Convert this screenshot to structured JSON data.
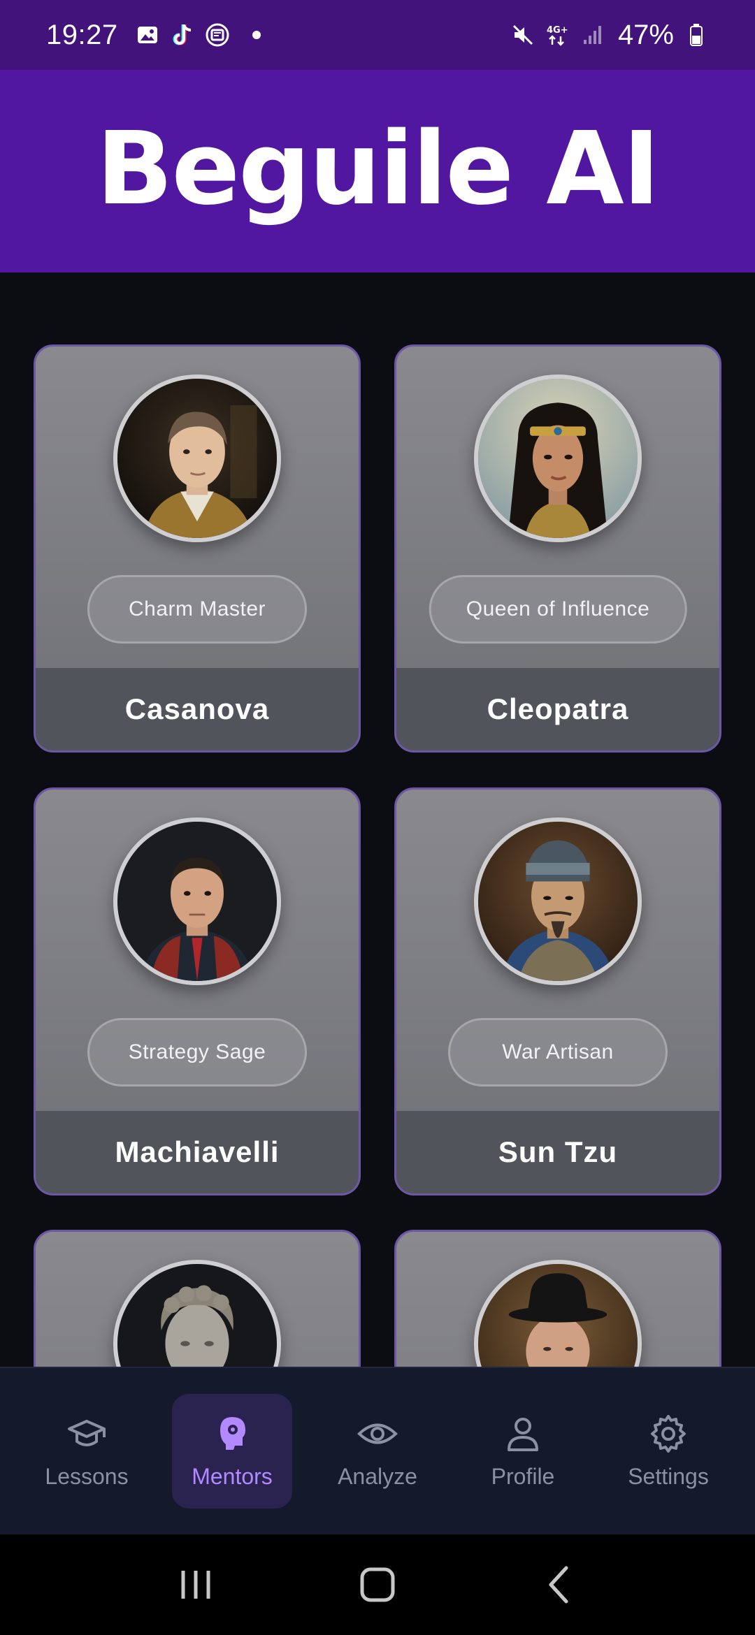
{
  "status_bar": {
    "time": "19:27",
    "battery": "47%",
    "notification_icons": [
      "gallery-icon",
      "tiktok-icon",
      "app-icon",
      "dot-icon"
    ],
    "system_icons": [
      "mute-icon",
      "4g-icon",
      "signal-icon",
      "battery-icon"
    ]
  },
  "header": {
    "title": "Beguile AI"
  },
  "mentors": [
    {
      "name": "Casanova",
      "tag": "Charm Master"
    },
    {
      "name": "Cleopatra",
      "tag": "Queen of Influence"
    },
    {
      "name": "Machiavelli",
      "tag": "Strategy Sage"
    },
    {
      "name": "Sun Tzu",
      "tag": "War Artisan"
    },
    {
      "name": "",
      "tag": ""
    },
    {
      "name": "",
      "tag": ""
    }
  ],
  "bottom_nav": {
    "items": [
      {
        "label": "Lessons",
        "icon": "graduation-cap-icon"
      },
      {
        "label": "Mentors",
        "icon": "mentor-head-icon",
        "active": true
      },
      {
        "label": "Analyze",
        "icon": "eye-icon"
      },
      {
        "label": "Profile",
        "icon": "user-icon"
      },
      {
        "label": "Settings",
        "icon": "gear-icon"
      }
    ]
  },
  "colors": {
    "status_bar_bg": "#42137a",
    "header_bg": "#5117a0",
    "page_bg": "#0b0d12",
    "card_border": "#6e57a6",
    "nav_bg": "#141a2b",
    "nav_active": "#b289ff"
  }
}
